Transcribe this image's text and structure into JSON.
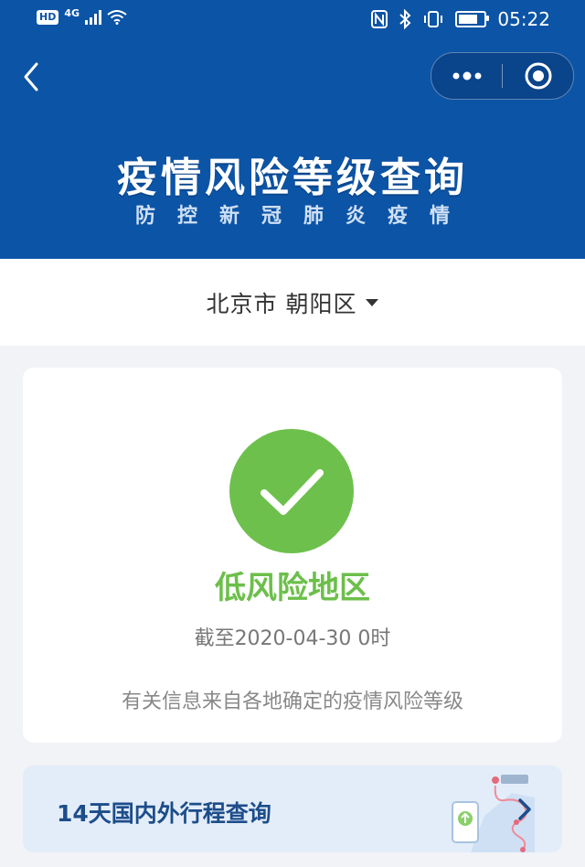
{
  "status_bar": {
    "left_badge": "HD",
    "network": "4G",
    "time": "05:22"
  },
  "header": {
    "title": "疫情风险等级查询",
    "subtitle": "防控新冠肺炎疫情"
  },
  "location": {
    "label": "北京市 朝阳区"
  },
  "result": {
    "risk_level": "低风险地区",
    "as_of": "截至2020-04-30 0时",
    "note": "有关信息来自各地确定的疫情风险等级",
    "status_color": "#6ec04d"
  },
  "travel": {
    "label": "14天国内外行程查询"
  },
  "colors": {
    "header_bg": "#0c54a6",
    "accent_green": "#6cbf4a",
    "link_blue": "#1d4d8a"
  },
  "icons": [
    "back-arrow-icon",
    "more-icon",
    "target-close-icon",
    "check-icon",
    "caret-down-icon",
    "chevron-right-icon"
  ]
}
